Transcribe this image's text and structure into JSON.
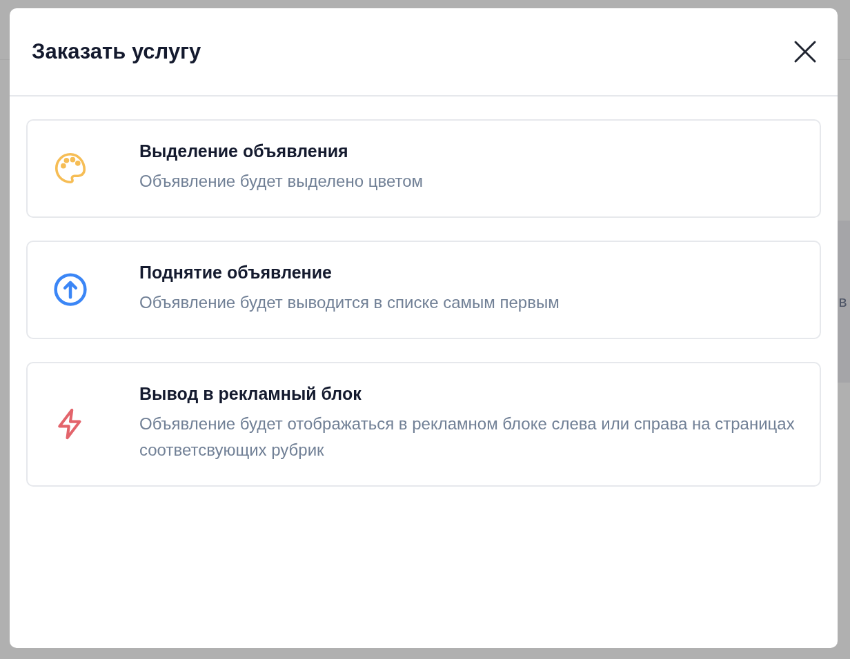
{
  "background": {
    "fragment_text": "в"
  },
  "dialog": {
    "title": "Заказать услугу",
    "services": [
      {
        "kind": "palette",
        "color": "#f6bd55",
        "title": "Выделение объявления",
        "description": "Объявление будет выделено цветом"
      },
      {
        "kind": "arrow-up",
        "color": "#3b86f6",
        "title": "Поднятие объявление",
        "description": "Объявление будет выводится в списке самым первым"
      },
      {
        "kind": "bolt",
        "color": "#e3646b",
        "title": "Вывод в рекламный блок",
        "description": "Объявление будет отображаться в рекламном блоке слева или справа на страницах соответсвующих рубрик"
      }
    ]
  }
}
